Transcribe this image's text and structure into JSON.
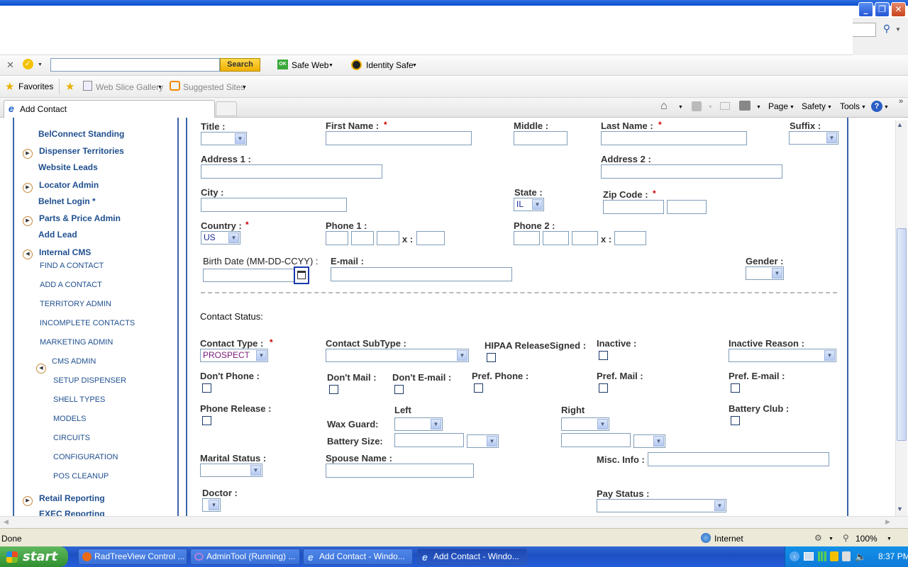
{
  "window": {
    "minimize": "_",
    "restore": "❐",
    "close": "✕"
  },
  "toolbar": {
    "search_label": "Search",
    "safe_web": "Safe Web",
    "identity_safe": "Identity Safe",
    "favorites": "Favorites",
    "web_slice_gallery": "Web Slice Gallery",
    "suggested_sites": "Suggested Sites",
    "page": "Page",
    "safety": "Safety",
    "tools": "Tools"
  },
  "tab": {
    "title": "Add Contact"
  },
  "sidebar": {
    "belconnect": "BelConnect Standing",
    "dispenser_territories": "Dispenser Territories",
    "website_leads": "Website Leads",
    "locator_admin": "Locator Admin",
    "belnet_login": "Belnet Login *",
    "parts_price_admin": "Parts & Price Admin",
    "add_lead": "Add Lead",
    "internal_cms": "Internal CMS",
    "find_contact": "FIND A CONTACT",
    "add_contact": "ADD A CONTACT",
    "territory_admin": "TERRITORY ADMIN",
    "incomplete_contacts": "INCOMPLETE CONTACTS",
    "marketing_admin": "MARKETING ADMIN",
    "cms_admin": "CMS ADMIN",
    "setup_dispenser": "SETUP DISPENSER",
    "shell_types": "SHELL TYPES",
    "models": "MODELS",
    "circuits": "CIRCUITS",
    "configuration": "CONFIGURATION",
    "pos_cleanup": "POS CLEANUP",
    "retail_reporting": "Retail Reporting",
    "exec_reporting": "EXEC Reporting"
  },
  "form": {
    "title_label": "Title :",
    "first_name_label": "First Name :",
    "middle_label": "Middle :",
    "last_name_label": "Last Name :",
    "suffix_label": "Suffix :",
    "address1_label": "Address 1 :",
    "address2_label": "Address 2 :",
    "city_label": "City :",
    "state_label": "State :",
    "state_value": "IL",
    "zip_label": "Zip Code :",
    "country_label": "Country :",
    "country_value": "US",
    "phone1_label": "Phone 1 :",
    "phone2_label": "Phone 2 :",
    "x_sep": "x :",
    "birth_label": "Birth Date (MM-DD-CCYY) :",
    "email_label": "E-mail :",
    "gender_label": "Gender :",
    "required_mark": "*",
    "contact_status_heading": "Contact Status:",
    "contact_type_label": "Contact Type :",
    "contact_type_value": "PROSPECT",
    "contact_subtype_label": "Contact SubType :",
    "hipaa_label": "HIPAA ReleaseSigned :",
    "inactive_label": "Inactive :",
    "inactive_reason_label": "Inactive Reason :",
    "dont_phone_label": "Don't Phone :",
    "dont_mail_label": "Don't Mail :",
    "dont_email_label": "Don't E-mail :",
    "pref_phone_label": "Pref. Phone :",
    "pref_mail_label": "Pref. Mail :",
    "pref_email_label": "Pref. E-mail :",
    "phone_release_label": "Phone Release :",
    "left_label": "Left",
    "right_label": "Right",
    "battery_club_label": "Battery Club :",
    "wax_guard_label": "Wax Guard:",
    "battery_size_label": "Battery Size:",
    "marital_status_label": "Marital Status :",
    "spouse_name_label": "Spouse Name :",
    "misc_info_label": "Misc. Info :",
    "doctor_label": "Doctor :",
    "pay_status_label": "Pay Status :"
  },
  "statusbar": {
    "status": "Done",
    "zone": "Internet",
    "zoom": "100%"
  },
  "taskbar": {
    "start": "start",
    "tasks": [
      "RadTreeView Control ...",
      "AdminTool (Running) ...",
      "Add Contact - Windo...",
      "Add Contact - Windo..."
    ],
    "clock": "8:37 PM"
  }
}
